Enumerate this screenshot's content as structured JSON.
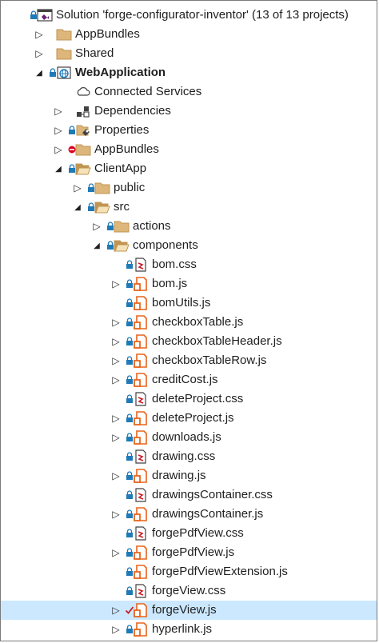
{
  "colors": {
    "folder": "#dcb67a",
    "folder_dark": "#c09553",
    "js_orange": "#e8631a",
    "css_red": "#c81e28",
    "lock_blue": "#1f7ab8",
    "selection": "#cce8ff",
    "minus_red": "#d9001b"
  },
  "tree": [
    {
      "label": "Solution 'forge-configurator-inventor' (13 of 13 projects)",
      "level": 0,
      "icon": "solution-icon",
      "arrow": "none",
      "badge": "lock"
    },
    {
      "label": "AppBundles",
      "level": 1,
      "icon": "folder-icon",
      "arrow": "collapsed",
      "badge": "none"
    },
    {
      "label": "Shared",
      "level": 1,
      "icon": "folder-icon",
      "arrow": "collapsed",
      "badge": "none"
    },
    {
      "label": "WebApplication",
      "level": 1,
      "icon": "web-project-icon",
      "arrow": "expanded",
      "badge": "lock",
      "bold": true
    },
    {
      "label": "Connected Services",
      "level": 2,
      "icon": "connected-services-icon",
      "arrow": "none",
      "badge": "none"
    },
    {
      "label": "Dependencies",
      "level": 2,
      "icon": "dependencies-icon",
      "arrow": "collapsed",
      "badge": "none"
    },
    {
      "label": "Properties",
      "level": 2,
      "icon": "properties-icon",
      "arrow": "collapsed",
      "badge": "lock"
    },
    {
      "label": "AppBundles",
      "level": 2,
      "icon": "folder-icon",
      "arrow": "collapsed",
      "badge": "minus"
    },
    {
      "label": "ClientApp",
      "level": 2,
      "icon": "folder-open-icon",
      "arrow": "expanded",
      "badge": "lock"
    },
    {
      "label": "public",
      "level": 3,
      "icon": "folder-icon",
      "arrow": "collapsed",
      "badge": "lock"
    },
    {
      "label": "src",
      "level": 3,
      "icon": "folder-open-icon",
      "arrow": "expanded",
      "badge": "lock"
    },
    {
      "label": "actions",
      "level": 4,
      "icon": "folder-icon",
      "arrow": "collapsed",
      "badge": "lock"
    },
    {
      "label": "components",
      "level": 4,
      "icon": "folder-open-icon",
      "arrow": "expanded",
      "badge": "lock"
    },
    {
      "label": "bom.css",
      "level": 5,
      "icon": "css-file-icon",
      "arrow": "none",
      "badge": "lock"
    },
    {
      "label": "bom.js",
      "level": 5,
      "icon": "js-file-icon",
      "arrow": "collapsed",
      "badge": "lock"
    },
    {
      "label": "bomUtils.js",
      "level": 5,
      "icon": "js-file-icon",
      "arrow": "none",
      "badge": "lock"
    },
    {
      "label": "checkboxTable.js",
      "level": 5,
      "icon": "js-file-icon",
      "arrow": "collapsed",
      "badge": "lock"
    },
    {
      "label": "checkboxTableHeader.js",
      "level": 5,
      "icon": "js-file-icon",
      "arrow": "collapsed",
      "badge": "lock"
    },
    {
      "label": "checkboxTableRow.js",
      "level": 5,
      "icon": "js-file-icon",
      "arrow": "collapsed",
      "badge": "lock"
    },
    {
      "label": "creditCost.js",
      "level": 5,
      "icon": "js-file-icon",
      "arrow": "collapsed",
      "badge": "lock"
    },
    {
      "label": "deleteProject.css",
      "level": 5,
      "icon": "css-file-icon",
      "arrow": "none",
      "badge": "lock"
    },
    {
      "label": "deleteProject.js",
      "level": 5,
      "icon": "js-file-icon",
      "arrow": "collapsed",
      "badge": "lock"
    },
    {
      "label": "downloads.js",
      "level": 5,
      "icon": "js-file-icon",
      "arrow": "collapsed",
      "badge": "lock"
    },
    {
      "label": "drawing.css",
      "level": 5,
      "icon": "css-file-icon",
      "arrow": "none",
      "badge": "lock"
    },
    {
      "label": "drawing.js",
      "level": 5,
      "icon": "js-file-icon",
      "arrow": "collapsed",
      "badge": "lock"
    },
    {
      "label": "drawingsContainer.css",
      "level": 5,
      "icon": "css-file-icon",
      "arrow": "none",
      "badge": "lock"
    },
    {
      "label": "drawingsContainer.js",
      "level": 5,
      "icon": "js-file-icon",
      "arrow": "collapsed",
      "badge": "lock"
    },
    {
      "label": "forgePdfView.css",
      "level": 5,
      "icon": "css-file-icon",
      "arrow": "none",
      "badge": "lock"
    },
    {
      "label": "forgePdfView.js",
      "level": 5,
      "icon": "js-file-icon",
      "arrow": "collapsed",
      "badge": "lock"
    },
    {
      "label": "forgePdfViewExtension.js",
      "level": 5,
      "icon": "js-file-icon",
      "arrow": "none",
      "badge": "lock"
    },
    {
      "label": "forgeView.css",
      "level": 5,
      "icon": "css-file-icon",
      "arrow": "none",
      "badge": "lock"
    },
    {
      "label": "forgeView.js",
      "level": 5,
      "icon": "js-file-icon",
      "arrow": "collapsed",
      "badge": "check",
      "selected": true
    },
    {
      "label": "hyperlink.js",
      "level": 5,
      "icon": "js-file-icon",
      "arrow": "collapsed",
      "badge": "lock"
    }
  ]
}
